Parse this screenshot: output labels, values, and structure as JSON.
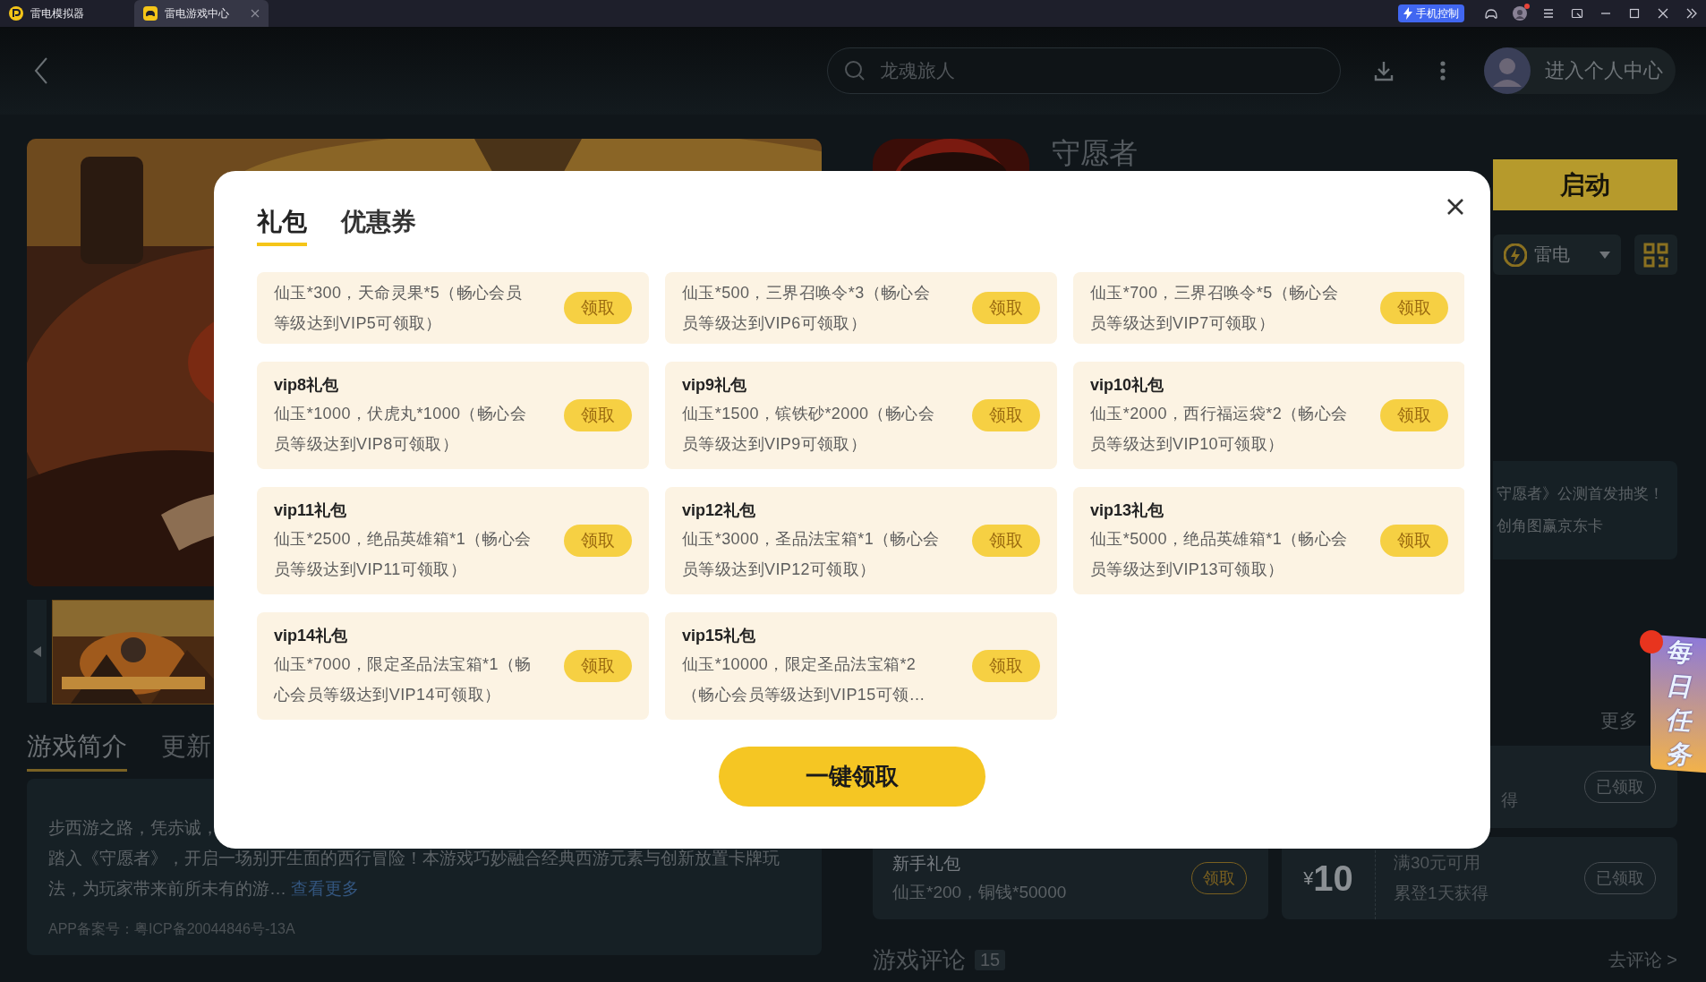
{
  "titlebar": {
    "tabs": [
      {
        "label": "雷电模拟器",
        "selected": false,
        "closable": false
      },
      {
        "label": "雷电游戏中心",
        "selected": true,
        "closable": true
      }
    ],
    "phone_control_button": "手机控制",
    "notification_dot": true
  },
  "header": {
    "search": {
      "placeholder": "龙魂旅人"
    },
    "profile_button": "进入个人中心"
  },
  "game": {
    "title": "守愿者",
    "launch_button": "启动",
    "account_dropdown": "雷电"
  },
  "detail_tabs": [
    {
      "label": "游戏简介",
      "selected": true
    },
    {
      "label": "更新",
      "selected": false
    }
  ],
  "intro": {
    "line_1": "步西游之路，凭赤诚，",
    "line_2": "踏入《守愿者》，开启一场别开生面的西行冒险！本游戏巧妙融合经典西游元素与创新放置卡牌玩法，为玩家带来前所未有的游…",
    "more_link": "查看更多",
    "icp": "APP备案号：粤ICP备20044846号-13A"
  },
  "news": {
    "lines": [
      "守愿者》公测首发抽奖！",
      "创角图赢京东卡"
    ]
  },
  "more_link": "更多",
  "rewards": [
    {
      "kind": "covered",
      "text": "得",
      "button": "已领取",
      "claimed": true
    },
    {
      "kind": "gift",
      "title": "新手礼包",
      "desc": "仙玉*200，铜钱*50000",
      "button": "领取",
      "claimed": false
    },
    {
      "kind": "coupon",
      "currency": "¥",
      "amount": "10",
      "condition": "满30元可用",
      "desc": "累登1天获得",
      "button": "已领取",
      "claimed": true
    }
  ],
  "reviews": {
    "title": "游戏评论",
    "count": "15",
    "action": "去评论 >"
  },
  "daily_task": {
    "label": "每日任务",
    "dot": true
  },
  "modal": {
    "tabs": [
      {
        "label": "礼包",
        "selected": true
      },
      {
        "label": "优惠券",
        "selected": false
      }
    ],
    "gifts": [
      {
        "desc": "仙玉*300，天命灵果*5（畅心会员等级达到VIP5可领取）",
        "button": "领取"
      },
      {
        "desc": "仙玉*500，三界召唤令*3（畅心会员等级达到VIP6可领取）",
        "button": "领取"
      },
      {
        "desc": "仙玉*700，三界召唤令*5（畅心会员等级达到VIP7可领取）",
        "button": "领取"
      },
      {
        "title": "vip8礼包",
        "desc": "仙玉*1000，伏虎丸*1000（畅心会员等级达到VIP8可领取）",
        "button": "领取"
      },
      {
        "title": "vip9礼包",
        "desc": "仙玉*1500，镔铁砂*2000（畅心会员等级达到VIP9可领取）",
        "button": "领取"
      },
      {
        "title": "vip10礼包",
        "desc": "仙玉*2000，西行福运袋*2（畅心会员等级达到VIP10可领取）",
        "button": "领取"
      },
      {
        "title": "vip11礼包",
        "desc": "仙玉*2500，绝品英雄箱*1（畅心会员等级达到VIP11可领取）",
        "button": "领取"
      },
      {
        "title": "vip12礼包",
        "desc": "仙玉*3000，圣品法宝箱*1（畅心会员等级达到VIP12可领取）",
        "button": "领取"
      },
      {
        "title": "vip13礼包",
        "desc": "仙玉*5000，绝品英雄箱*1（畅心会员等级达到VIP13可领取）",
        "button": "领取"
      },
      {
        "title": "vip14礼包",
        "desc": "仙玉*7000，限定圣品法宝箱*1（畅心会员等级达到VIP14可领取）",
        "button": "领取"
      },
      {
        "title": "vip15礼包",
        "desc": "仙玉*10000，限定圣品法宝箱*2（畅心会员等级达到VIP15可领…",
        "button": "领取"
      }
    ],
    "claim_all_button": "一键领取"
  }
}
